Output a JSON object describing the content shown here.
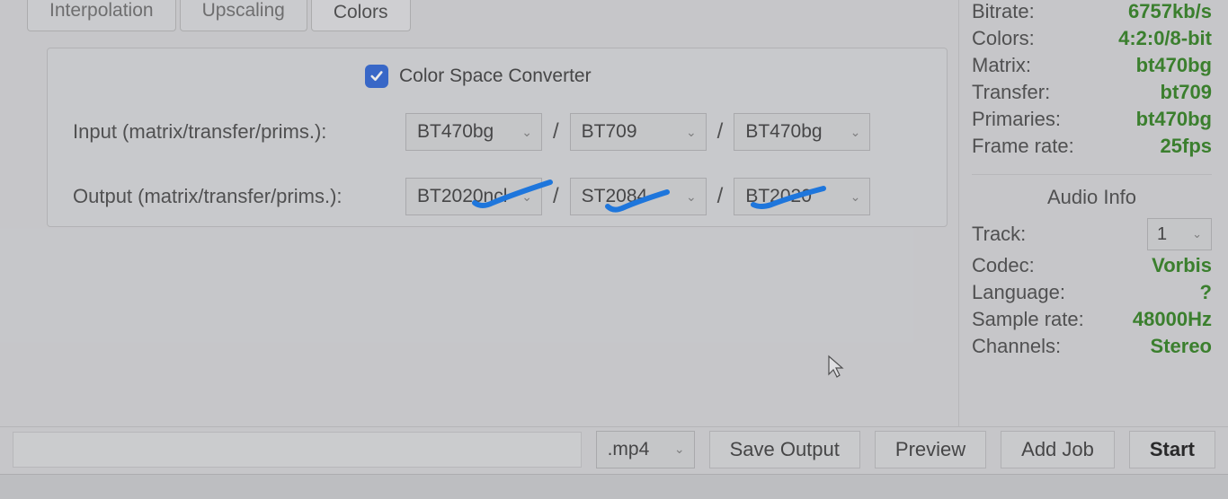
{
  "tabs": {
    "interpolation": "Interpolation",
    "upscaling": "Upscaling",
    "colors": "Colors"
  },
  "group": {
    "checkbox_label": "Color Space Converter",
    "input_label": "Input (matrix/transfer/prims.):",
    "output_label": "Output (matrix/transfer/prims.):",
    "input_matrix": "BT470bg",
    "input_transfer": "BT709",
    "input_prims": "BT470bg",
    "output_matrix": "BT2020ncl",
    "output_transfer": "ST2084",
    "output_prims": "BT2020"
  },
  "video_info": {
    "bitrate_label": "Bitrate:",
    "bitrate": "6757kb/s",
    "colors_label": "Colors:",
    "colors": "4:2:0/8-bit",
    "matrix_label": "Matrix:",
    "matrix": "bt470bg",
    "transfer_label": "Transfer:",
    "transfer": "bt709",
    "primaries_label": "Primaries:",
    "primaries": "bt470bg",
    "framerate_label": "Frame rate:",
    "framerate": "25fps"
  },
  "audio_section_title": "Audio Info",
  "audio_info": {
    "track_label": "Track:",
    "track": "1",
    "codec_label": "Codec:",
    "codec": "Vorbis",
    "language_label": "Language:",
    "language": "?",
    "samplerate_label": "Sample rate:",
    "samplerate": "48000Hz",
    "channels_label": "Channels:",
    "channels": "Stereo"
  },
  "bottom": {
    "ext": ".mp4",
    "save_output": "Save Output",
    "preview": "Preview",
    "add_job": "Add Job",
    "start": "Start"
  }
}
